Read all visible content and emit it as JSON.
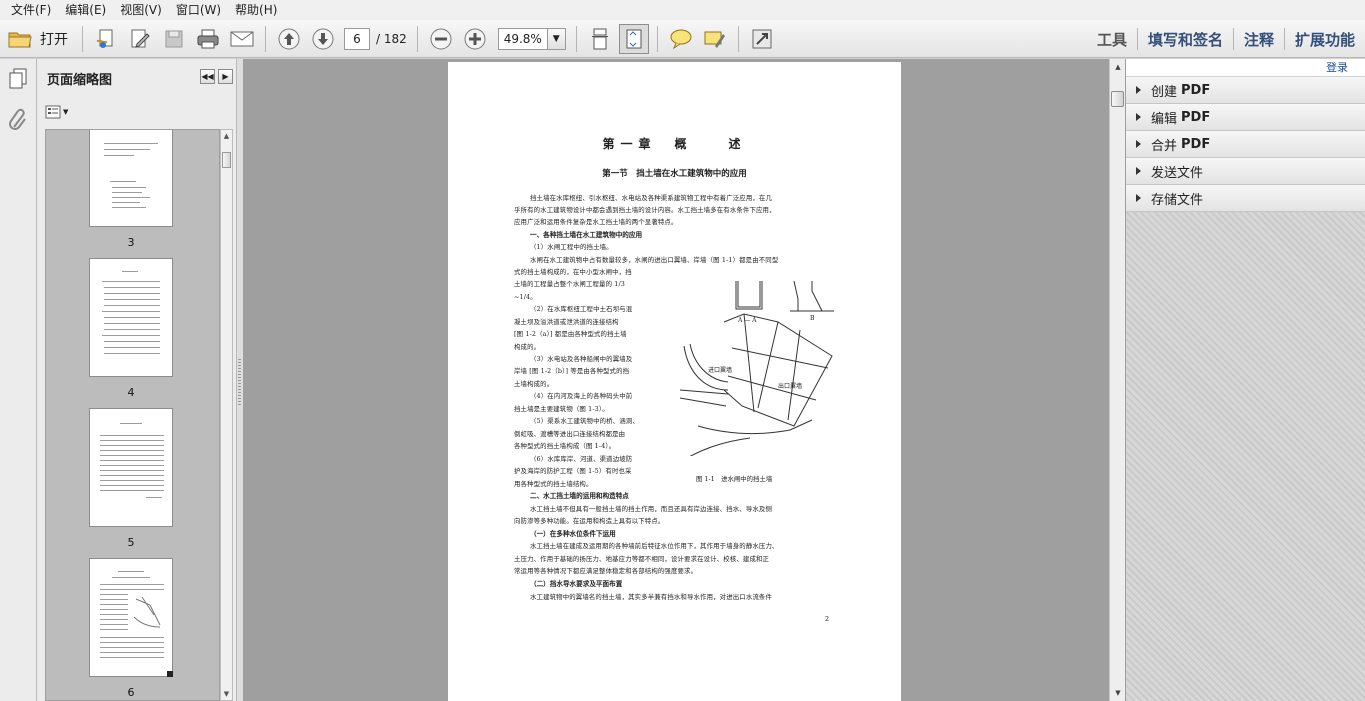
{
  "menu": [
    "文件(F)",
    "编辑(E)",
    "视图(V)",
    "窗口(W)",
    "帮助(H)"
  ],
  "toolbar": {
    "open_label": "打开",
    "current_page": "6",
    "total_pages": "/ 182",
    "zoom": "49.8%",
    "right": [
      "工具",
      "填写和签名",
      "注释",
      "扩展功能"
    ]
  },
  "thumbnails": {
    "title": "页面缩略图",
    "pages": [
      "3",
      "4",
      "5",
      "6"
    ]
  },
  "task_panel": {
    "login": "登录",
    "items": [
      {
        "prefix": "创建",
        "suffix": "PDF"
      },
      {
        "prefix": "编辑",
        "suffix": "PDF"
      },
      {
        "prefix": "合并",
        "suffix": "PDF"
      },
      {
        "prefix": "发送文件",
        "suffix": ""
      },
      {
        "prefix": "存储文件",
        "suffix": ""
      }
    ]
  },
  "document": {
    "chapter": "第一章　概　　述",
    "section": "第一节　挡土墙在水工建筑物中的应用",
    "lines": [
      "挡土墙在水库枢纽、引水枢纽、水电站及各种渠系建筑物工程中有着广泛应用，在几",
      "乎所有的水工建筑物设计中都会遇到挡土墙的设计内容。水工挡土墙多在有水条件下应用，",
      "应用广泛和运用条件复杂是水工挡土墙的两个显著特点。",
      "一、各种挡土墙在水工建筑物中的应用",
      "（1）水闸工程中的挡土墙。",
      "水闸在水工建筑物中占有数量较多，水闸的进出口翼墙、岸墙（图 1-1）都是由不同型",
      "式的挡土墙构成的，在中小型水闸中，挡",
      "土墙的工程量占整个水闸工程量的 1/3",
      "~1/4。",
      "（2）在水库枢纽工程中土石坝与混",
      "凝土坝及溢洪道或泄洪道的连接结构",
      "[图 1-2（a）] 都是由各种型式的挡土墙",
      "构成的。",
      "（3）水电站及各种船闸中的翼墙及",
      "岸墙 [图 1-2（b）] 等是由各种型式的挡",
      "土墙构成的。",
      "（4）在内河及海上的各种码头中前",
      "挡土墙是主要建筑物（图 1-3）。",
      "（5）渠系水工建筑物中的桥、涵洞、",
      "倒虹吸、渡槽等进出口连接结构都是由",
      "各种型式的挡土墙构成（图 1-4）。",
      "（6）水库库岸、河道、渠道边坡防",
      "护及海岸的防护工程（图 1-5）有时也采",
      "用各种型式的挡土墙结构。",
      "二、水工挡土墙的运用和构造特点",
      "水工挡土墙不但具有一般挡土墙的挡土作用，而且还具有岸边连接、挡水、导水及侧",
      "向防渗等多种功能。在运用和构造上具有以下特点。",
      "（一）在多种水位条件下运用",
      "水工挡土墙在建成及运用期的各种墙前后特征水位作用下，其作用于墙身的静水压力、",
      "土压力、作用于基础的扬压力、地基应力等都不相同，设计要求在设计、校核、建成和正",
      "常运用等各种情况下都应满足整体稳定和各部结构的强度要求。",
      "（二）挡水导水要求及平面布置",
      "水工建筑物中的翼墙名的挡土墙，其实多半兼有挡水和导水作用，对进出口水流条件"
    ],
    "figure_caption": "图 1-1　进水闸中的挡土墙",
    "figure_labels": [
      "A — A",
      "B",
      "进口翼墙",
      "出口翼墙"
    ],
    "page_number": "2"
  }
}
